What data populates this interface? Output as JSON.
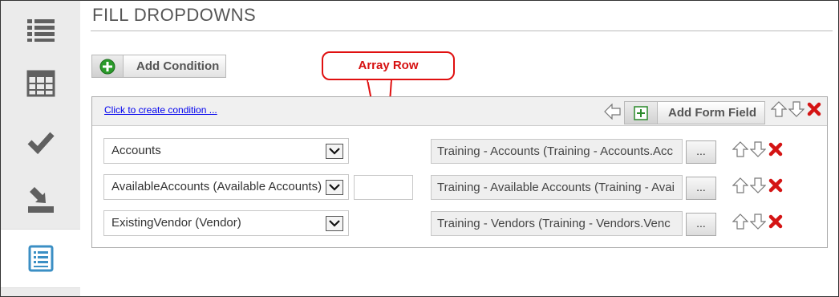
{
  "page": {
    "title": "FILL DROPDOWNS"
  },
  "sidebar": {
    "items": [
      {
        "name": "list-view",
        "icon": "list-icon"
      },
      {
        "name": "grid-view",
        "icon": "table-icon"
      },
      {
        "name": "validate",
        "icon": "checkmark-icon"
      },
      {
        "name": "import",
        "icon": "download-tray-icon"
      },
      {
        "name": "form-list",
        "icon": "form-list-icon",
        "active": true
      }
    ]
  },
  "toolbar": {
    "add_condition_label": "Add Condition"
  },
  "panel": {
    "create_condition_link": "Click to create condition ...",
    "add_form_field_label": "Add Form Field",
    "rows": [
      {
        "source": "Accounts",
        "target": "Training - Accounts (Training - Accounts.Acc",
        "ellipsis": "...",
        "has_array_input": false
      },
      {
        "source": "AvailableAccounts (Available Accounts)",
        "target": "Training - Available Accounts (Training - Avai",
        "ellipsis": "...",
        "has_array_input": true,
        "array_row_value": ""
      },
      {
        "source": "ExistingVendor (Vendor)",
        "target": "Training  - Vendors (Training  - Vendors.Venc",
        "ellipsis": "...",
        "has_array_input": false
      }
    ]
  },
  "callout": {
    "text": "Array Row"
  },
  "colors": {
    "accent_red": "#e01010",
    "link_blue": "#0000ee",
    "sidebar_icon": "#606060",
    "active_icon": "#3b8fc4",
    "add_green": "#2a9a2a"
  }
}
